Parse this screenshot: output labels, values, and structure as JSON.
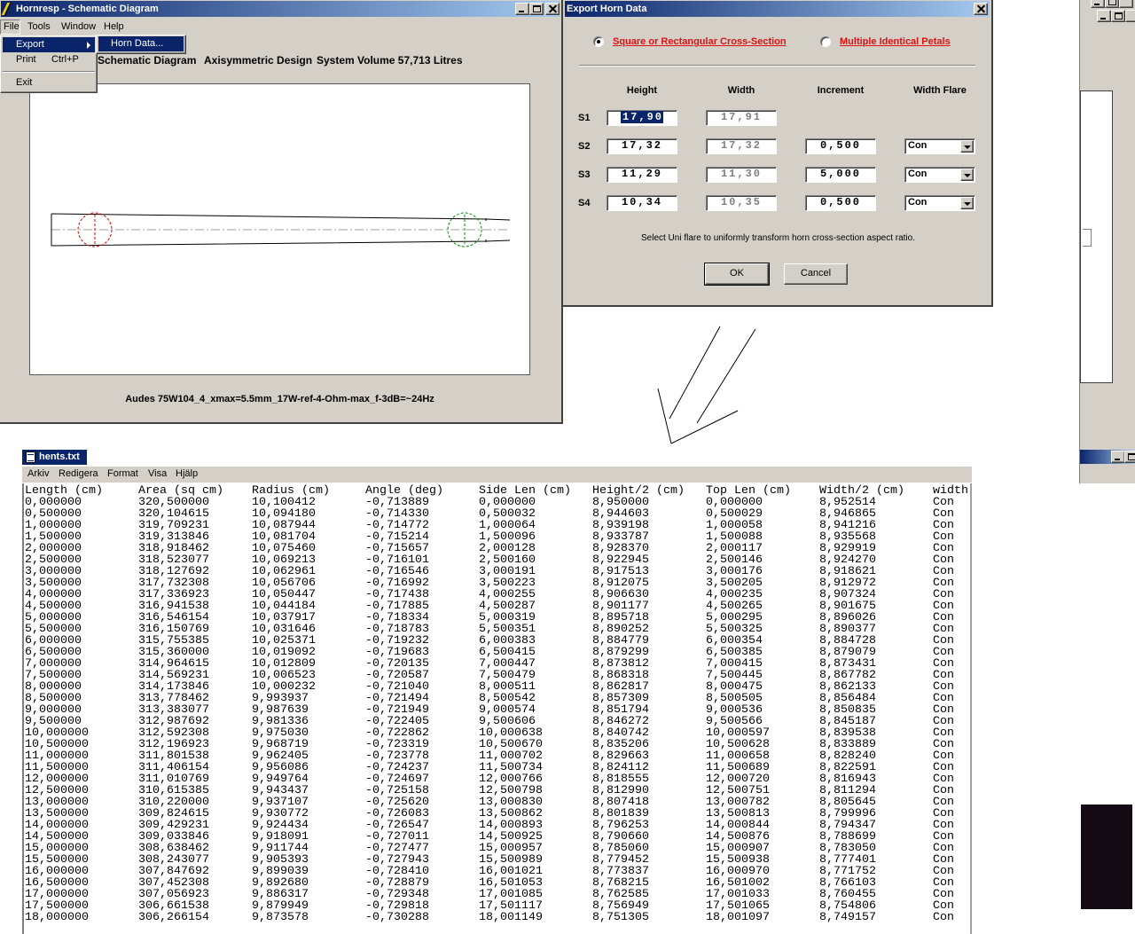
{
  "hornresp_window": {
    "title": "Hornresp - Schematic Diagram",
    "menu": [
      "File",
      "Tools",
      "Window",
      "Help"
    ],
    "file_menu": {
      "export": "Export",
      "print": "Print",
      "print_shortcut": "Ctrl+P",
      "exit": "Exit"
    },
    "export_submenu": {
      "horn_data": "Horn Data..."
    },
    "header": {
      "view": "Schematic Diagram",
      "design": "Axisymmetric Design",
      "volume": "System Volume 57,713 Litres"
    },
    "caption": "Audes 75W104_4_xmax=5.5mm_17W-ref-4-Ohm-max_f-3dB=~24Hz"
  },
  "export_dialog": {
    "title": "Export Horn Data",
    "cross_section_options": [
      {
        "label": "Square or Rectangular Cross-Section",
        "selected": true
      },
      {
        "label": "Multiple Identical Petals",
        "selected": false
      }
    ],
    "columns": [
      "Height",
      "Width",
      "Increment",
      "Width Flare"
    ],
    "rows": [
      {
        "label": "S1",
        "height": "17,90",
        "width": "17,91"
      },
      {
        "label": "S2",
        "height": "17,32",
        "width": "17,32",
        "increment": "0,500",
        "flare": "Con"
      },
      {
        "label": "S3",
        "height": "11,29",
        "width": "11,30",
        "increment": "5,000",
        "flare": "Con"
      },
      {
        "label": "S4",
        "height": "10,34",
        "width": "10,35",
        "increment": "0,500",
        "flare": "Con"
      }
    ],
    "hint": "Select Uni flare to uniformly transform horn cross-section aspect ratio.",
    "ok": "OK",
    "cancel": "Cancel",
    "label_color": "#e01010"
  },
  "textfile": {
    "title": "hents.txt",
    "menu": [
      "Arkiv",
      "Redigera",
      "Format",
      "Visa",
      "Hjälp"
    ],
    "columns": [
      "Length (cm)",
      "Area (sq cm)",
      "Radius (cm)",
      "Angle (deg)",
      "Side Len (cm)",
      "Height/2 (cm)",
      "Top Len (cm)",
      "Width/2 (cm)",
      "width"
    ],
    "rows": [
      [
        "0,000000",
        "320,500000",
        "10,100412",
        "-0,713889",
        "0,000000",
        "8,950000",
        "0,000000",
        "8,952514",
        "Con"
      ],
      [
        "0,500000",
        "320,104615",
        "10,094180",
        "-0,714330",
        "0,500032",
        "8,944603",
        "0,500029",
        "8,946865",
        "Con"
      ],
      [
        "1,000000",
        "319,709231",
        "10,087944",
        "-0,714772",
        "1,000064",
        "8,939198",
        "1,000058",
        "8,941216",
        "Con"
      ],
      [
        "1,500000",
        "319,313846",
        "10,081704",
        "-0,715214",
        "1,500096",
        "8,933787",
        "1,500088",
        "8,935568",
        "Con"
      ],
      [
        "2,000000",
        "318,918462",
        "10,075460",
        "-0,715657",
        "2,000128",
        "8,928370",
        "2,000117",
        "8,929919",
        "Con"
      ],
      [
        "2,500000",
        "318,523077",
        "10,069213",
        "-0,716101",
        "2,500160",
        "8,922945",
        "2,500146",
        "8,924270",
        "Con"
      ],
      [
        "3,000000",
        "318,127692",
        "10,062961",
        "-0,716546",
        "3,000191",
        "8,917513",
        "3,000176",
        "8,918621",
        "Con"
      ],
      [
        "3,500000",
        "317,732308",
        "10,056706",
        "-0,716992",
        "3,500223",
        "8,912075",
        "3,500205",
        "8,912972",
        "Con"
      ],
      [
        "4,000000",
        "317,336923",
        "10,050447",
        "-0,717438",
        "4,000255",
        "8,906630",
        "4,000235",
        "8,907324",
        "Con"
      ],
      [
        "4,500000",
        "316,941538",
        "10,044184",
        "-0,717885",
        "4,500287",
        "8,901177",
        "4,500265",
        "8,901675",
        "Con"
      ],
      [
        "5,000000",
        "316,546154",
        "10,037917",
        "-0,718334",
        "5,000319",
        "8,895718",
        "5,000295",
        "8,896026",
        "Con"
      ],
      [
        "5,500000",
        "316,150769",
        "10,031646",
        "-0,718783",
        "5,500351",
        "8,890252",
        "5,500325",
        "8,890377",
        "Con"
      ],
      [
        "6,000000",
        "315,755385",
        "10,025371",
        "-0,719232",
        "6,000383",
        "8,884779",
        "6,000354",
        "8,884728",
        "Con"
      ],
      [
        "6,500000",
        "315,360000",
        "10,019092",
        "-0,719683",
        "6,500415",
        "8,879299",
        "6,500385",
        "8,879079",
        "Con"
      ],
      [
        "7,000000",
        "314,964615",
        "10,012809",
        "-0,720135",
        "7,000447",
        "8,873812",
        "7,000415",
        "8,873431",
        "Con"
      ],
      [
        "7,500000",
        "314,569231",
        "10,006523",
        "-0,720587",
        "7,500479",
        "8,868318",
        "7,500445",
        "8,867782",
        "Con"
      ],
      [
        "8,000000",
        "314,173846",
        "10,000232",
        "-0,721040",
        "8,000511",
        "8,862817",
        "8,000475",
        "8,862133",
        "Con"
      ],
      [
        "8,500000",
        "313,778462",
        "9,993937",
        "-0,721494",
        "8,500542",
        "8,857309",
        "8,500505",
        "8,856484",
        "Con"
      ],
      [
        "9,000000",
        "313,383077",
        "9,987639",
        "-0,721949",
        "9,000574",
        "8,851794",
        "9,000536",
        "8,850835",
        "Con"
      ],
      [
        "9,500000",
        "312,987692",
        "9,981336",
        "-0,722405",
        "9,500606",
        "8,846272",
        "9,500566",
        "8,845187",
        "Con"
      ],
      [
        "10,000000",
        "312,592308",
        "9,975030",
        "-0,722862",
        "10,000638",
        "8,840742",
        "10,000597",
        "8,839538",
        "Con"
      ],
      [
        "10,500000",
        "312,196923",
        "9,968719",
        "-0,723319",
        "10,500670",
        "8,835206",
        "10,500628",
        "8,833889",
        "Con"
      ],
      [
        "11,000000",
        "311,801538",
        "9,962405",
        "-0,723778",
        "11,000702",
        "8,829663",
        "11,000658",
        "8,828240",
        "Con"
      ],
      [
        "11,500000",
        "311,406154",
        "9,956086",
        "-0,724237",
        "11,500734",
        "8,824112",
        "11,500689",
        "8,822591",
        "Con"
      ],
      [
        "12,000000",
        "311,010769",
        "9,949764",
        "-0,724697",
        "12,000766",
        "8,818555",
        "12,000720",
        "8,816943",
        "Con"
      ],
      [
        "12,500000",
        "310,615385",
        "9,943437",
        "-0,725158",
        "12,500798",
        "8,812990",
        "12,500751",
        "8,811294",
        "Con"
      ],
      [
        "13,000000",
        "310,220000",
        "9,937107",
        "-0,725620",
        "13,000830",
        "8,807418",
        "13,000782",
        "8,805645",
        "Con"
      ],
      [
        "13,500000",
        "309,824615",
        "9,930772",
        "-0,726083",
        "13,500862",
        "8,801839",
        "13,500813",
        "8,799996",
        "Con"
      ],
      [
        "14,000000",
        "309,429231",
        "9,924434",
        "-0,726547",
        "14,000893",
        "8,796253",
        "14,000844",
        "8,794347",
        "Con"
      ],
      [
        "14,500000",
        "309,033846",
        "9,918091",
        "-0,727011",
        "14,500925",
        "8,790660",
        "14,500876",
        "8,788699",
        "Con"
      ],
      [
        "15,000000",
        "308,638462",
        "9,911744",
        "-0,727477",
        "15,000957",
        "8,785060",
        "15,000907",
        "8,783050",
        "Con"
      ],
      [
        "15,500000",
        "308,243077",
        "9,905393",
        "-0,727943",
        "15,500989",
        "8,779452",
        "15,500938",
        "8,777401",
        "Con"
      ],
      [
        "16,000000",
        "307,847692",
        "9,899039",
        "-0,728410",
        "16,001021",
        "8,773837",
        "16,000970",
        "8,771752",
        "Con"
      ],
      [
        "16,500000",
        "307,452308",
        "9,892680",
        "-0,728879",
        "16,501053",
        "8,768215",
        "16,501002",
        "8,766103",
        "Con"
      ],
      [
        "17,000000",
        "307,056923",
        "9,886317",
        "-0,729348",
        "17,001085",
        "8,762585",
        "17,001033",
        "8,760455",
        "Con"
      ],
      [
        "17,500000",
        "306,661538",
        "9,879949",
        "-0,729818",
        "17,501117",
        "8,756949",
        "17,501065",
        "8,754806",
        "Con"
      ],
      [
        "18,000000",
        "306,266154",
        "9,873578",
        "-0,730288",
        "18,001149",
        "8,751305",
        "18,001097",
        "8,749157",
        "Con"
      ]
    ]
  },
  "icons": {
    "window_minimize": "minimize-icon",
    "window_maximize": "maximize-icon",
    "window_close": "close-icon",
    "submenu_arrow": "chevron-right-icon",
    "combo_arrow": "chevron-down-icon"
  },
  "colors": {
    "window_face": "#d4d0c8",
    "title_active": "#0a246a",
    "title_gradient_end": "#a6caf0"
  }
}
